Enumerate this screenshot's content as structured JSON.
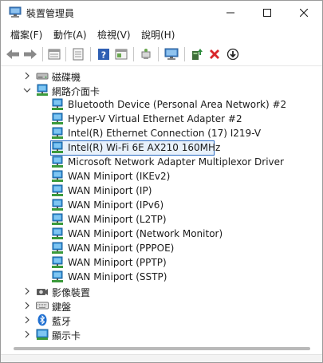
{
  "window": {
    "title": "裝置管理員"
  },
  "menu": [
    "檔案(F)",
    "動作(A)",
    "檢視(V)",
    "說明(H)"
  ],
  "toolbar": [
    {
      "icon": "back-arrow-icon"
    },
    {
      "icon": "forward-arrow-icon"
    },
    {
      "icon": "properties-icon"
    },
    {
      "icon": "driver-details-icon"
    },
    {
      "icon": "help-icon"
    },
    {
      "icon": "view-panel-icon"
    },
    {
      "icon": "scan-hardware-icon"
    },
    {
      "icon": "monitor-icon"
    },
    {
      "icon": "update-driver-icon"
    },
    {
      "icon": "uninstall-icon"
    },
    {
      "icon": "download-icon"
    }
  ],
  "tree": {
    "categories_top": [
      {
        "label": "磁碟機",
        "icon": "disk-drive-icon",
        "expanded": false
      }
    ],
    "network_category": {
      "label": "網路介面卡",
      "icon": "network-adapter-icon",
      "expanded": true
    },
    "network_adapters": [
      "Bluetooth Device (Personal Area Network) #2",
      "Hyper-V Virtual Ethernet Adapter #2",
      "Intel(R) Ethernet Connection (17) I219-V",
      "Intel(R) Wi-Fi 6E AX210 160MHz",
      "Microsoft Network Adapter Multiplexor Driver",
      "WAN Miniport (IKEv2)",
      "WAN Miniport (IP)",
      "WAN Miniport (IPv6)",
      "WAN Miniport (L2TP)",
      "WAN Miniport (Network Monitor)",
      "WAN Miniport (PPPOE)",
      "WAN Miniport (PPTP)",
      "WAN Miniport (SSTP)"
    ],
    "selected_adapter": "Intel(R) Wi-Fi 6E AX210 160MHz",
    "categories_bottom": [
      {
        "label": "影像裝置",
        "icon": "camera-icon"
      },
      {
        "label": "鍵盤",
        "icon": "keyboard-icon"
      },
      {
        "label": "藍牙",
        "icon": "bluetooth-icon"
      },
      {
        "label": "顯示卡",
        "icon": "display-adapter-icon"
      }
    ]
  },
  "colors": {
    "selection_border": "#2b6cc4",
    "selection_fill": "#e8f1fb",
    "network_icon": "#2a8ad4"
  }
}
